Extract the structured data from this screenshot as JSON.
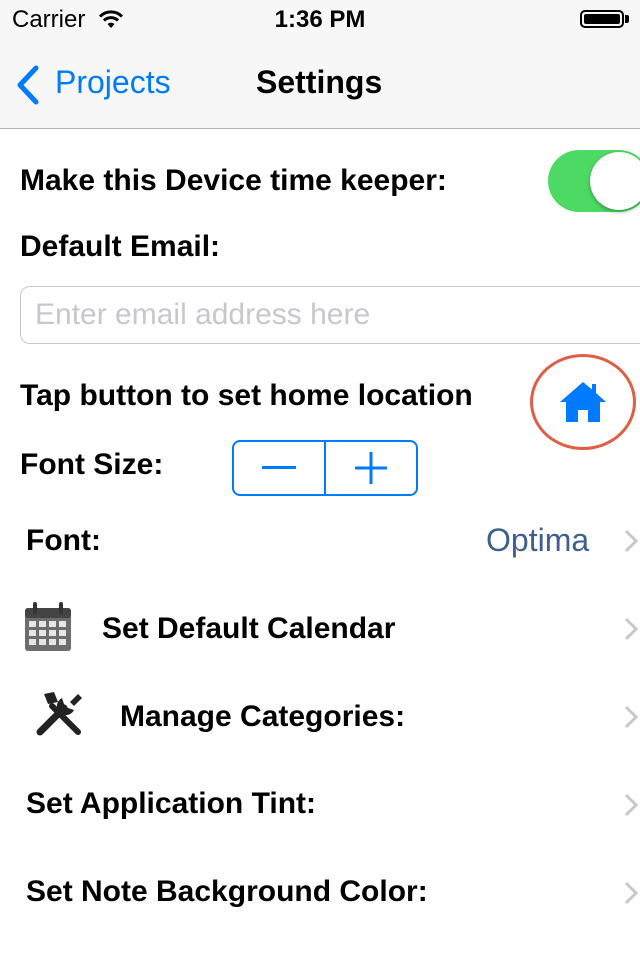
{
  "status_bar": {
    "carrier": "Carrier",
    "time": "1:36 PM",
    "icons": [
      "wifi-icon",
      "battery-icon"
    ]
  },
  "nav": {
    "back_label": "Projects",
    "title": "Settings"
  },
  "settings": {
    "time_keeper_label": "Make this Device time keeper:",
    "time_keeper_on": true,
    "default_email_label": "Default Email:",
    "email_value": "",
    "email_placeholder": "Enter email address here",
    "home_location_label": "Tap button to set home location",
    "font_size_label": "Font Size:",
    "font_label": "Font:",
    "font_value": "Optima",
    "calendar_label": "Set Default Calendar",
    "categories_label": "Manage Categories:",
    "tint_label": "Set Application Tint:",
    "note_bg_label": "Set Note Background Color:"
  },
  "colors": {
    "accent": "#007aff",
    "toggle_on": "#4cd964",
    "highlight_ring": "#e15e45",
    "font_value": "#3e5f8f"
  }
}
